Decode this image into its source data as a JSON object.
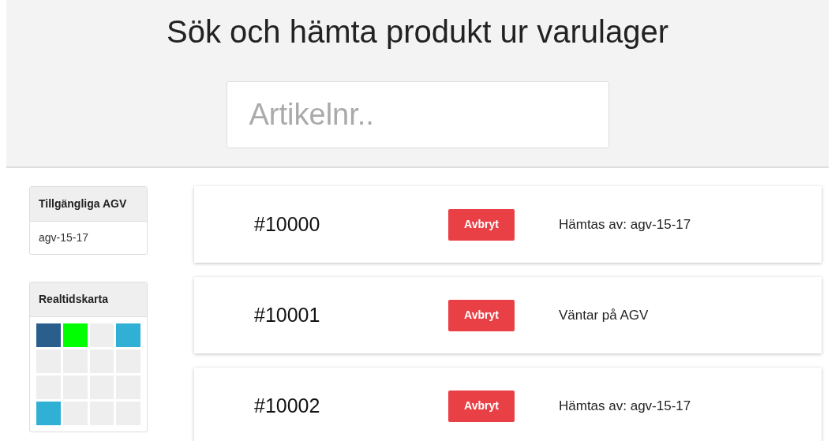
{
  "header": {
    "title": "Sök och hämta produkt ur varulager",
    "search": {
      "placeholder": "Artikelnr.."
    }
  },
  "agv_panel": {
    "title": "Tillgängliga AGV",
    "items": [
      "agv-15-17"
    ]
  },
  "map_panel": {
    "title": "Realtidskarta",
    "cells": [
      {
        "color": "#2a5f8d"
      },
      {
        "color": "#00ff00"
      },
      {
        "color": "#eeeeee"
      },
      {
        "color": "#31b0d5"
      },
      {
        "color": "#eeeeee"
      },
      {
        "color": "#eeeeee"
      },
      {
        "color": "#eeeeee"
      },
      {
        "color": "#eeeeee"
      },
      {
        "color": "#eeeeee"
      },
      {
        "color": "#eeeeee"
      },
      {
        "color": "#eeeeee"
      },
      {
        "color": "#eeeeee"
      },
      {
        "color": "#31b0d5"
      },
      {
        "color": "#eeeeee"
      },
      {
        "color": "#eeeeee"
      },
      {
        "color": "#eeeeee"
      }
    ]
  },
  "orders": [
    {
      "number": "#10000",
      "button": "Avbryt",
      "status": "Hämtas av: agv-15-17"
    },
    {
      "number": "#10001",
      "button": "Avbryt",
      "status": "Väntar på AGV"
    },
    {
      "number": "#10002",
      "button": "Avbryt",
      "status": "Hämtas av: agv-15-17"
    }
  ]
}
